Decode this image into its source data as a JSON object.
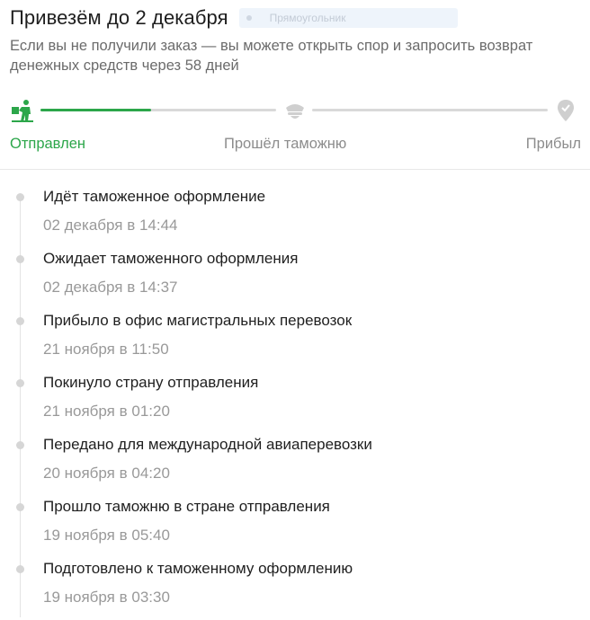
{
  "header": {
    "title": "Привезём до 2 декабря",
    "label_chip": "Прямоугольник",
    "subtitle": "Если вы не получили заказ — вы можете открыть спор и запросить возврат денежных средств через 58 дней"
  },
  "progress": {
    "fraction_first_segment": 0.47,
    "accent_color": "#2ca64a",
    "icons": [
      "courier-with-box-icon",
      "customs-officer-hat-icon",
      "location-pin-icon"
    ],
    "steps": [
      {
        "label": "Отправлен",
        "state": "done"
      },
      {
        "label": "Прошёл таможню",
        "state": "pending"
      },
      {
        "label": "Прибыл",
        "state": "pending"
      }
    ]
  },
  "events": [
    {
      "title": "Идёт таможенное оформление",
      "time": "02 декабря в 14:44"
    },
    {
      "title": "Ожидает таможенного оформления",
      "time": "02 декабря в 14:37"
    },
    {
      "title": "Прибыло в офис магистральных перевозок",
      "time": "21 ноября в 11:50"
    },
    {
      "title": "Покинуло страну отправления",
      "time": "21 ноября в 01:20"
    },
    {
      "title": "Передано для международной авиаперевозки",
      "time": "20 ноября в 04:20"
    },
    {
      "title": "Прошло таможню в стране отправления",
      "time": "19 ноября в 05:40"
    },
    {
      "title": "Подготовлено к таможенному оформлению",
      "time": "19 ноября в 03:30"
    }
  ]
}
